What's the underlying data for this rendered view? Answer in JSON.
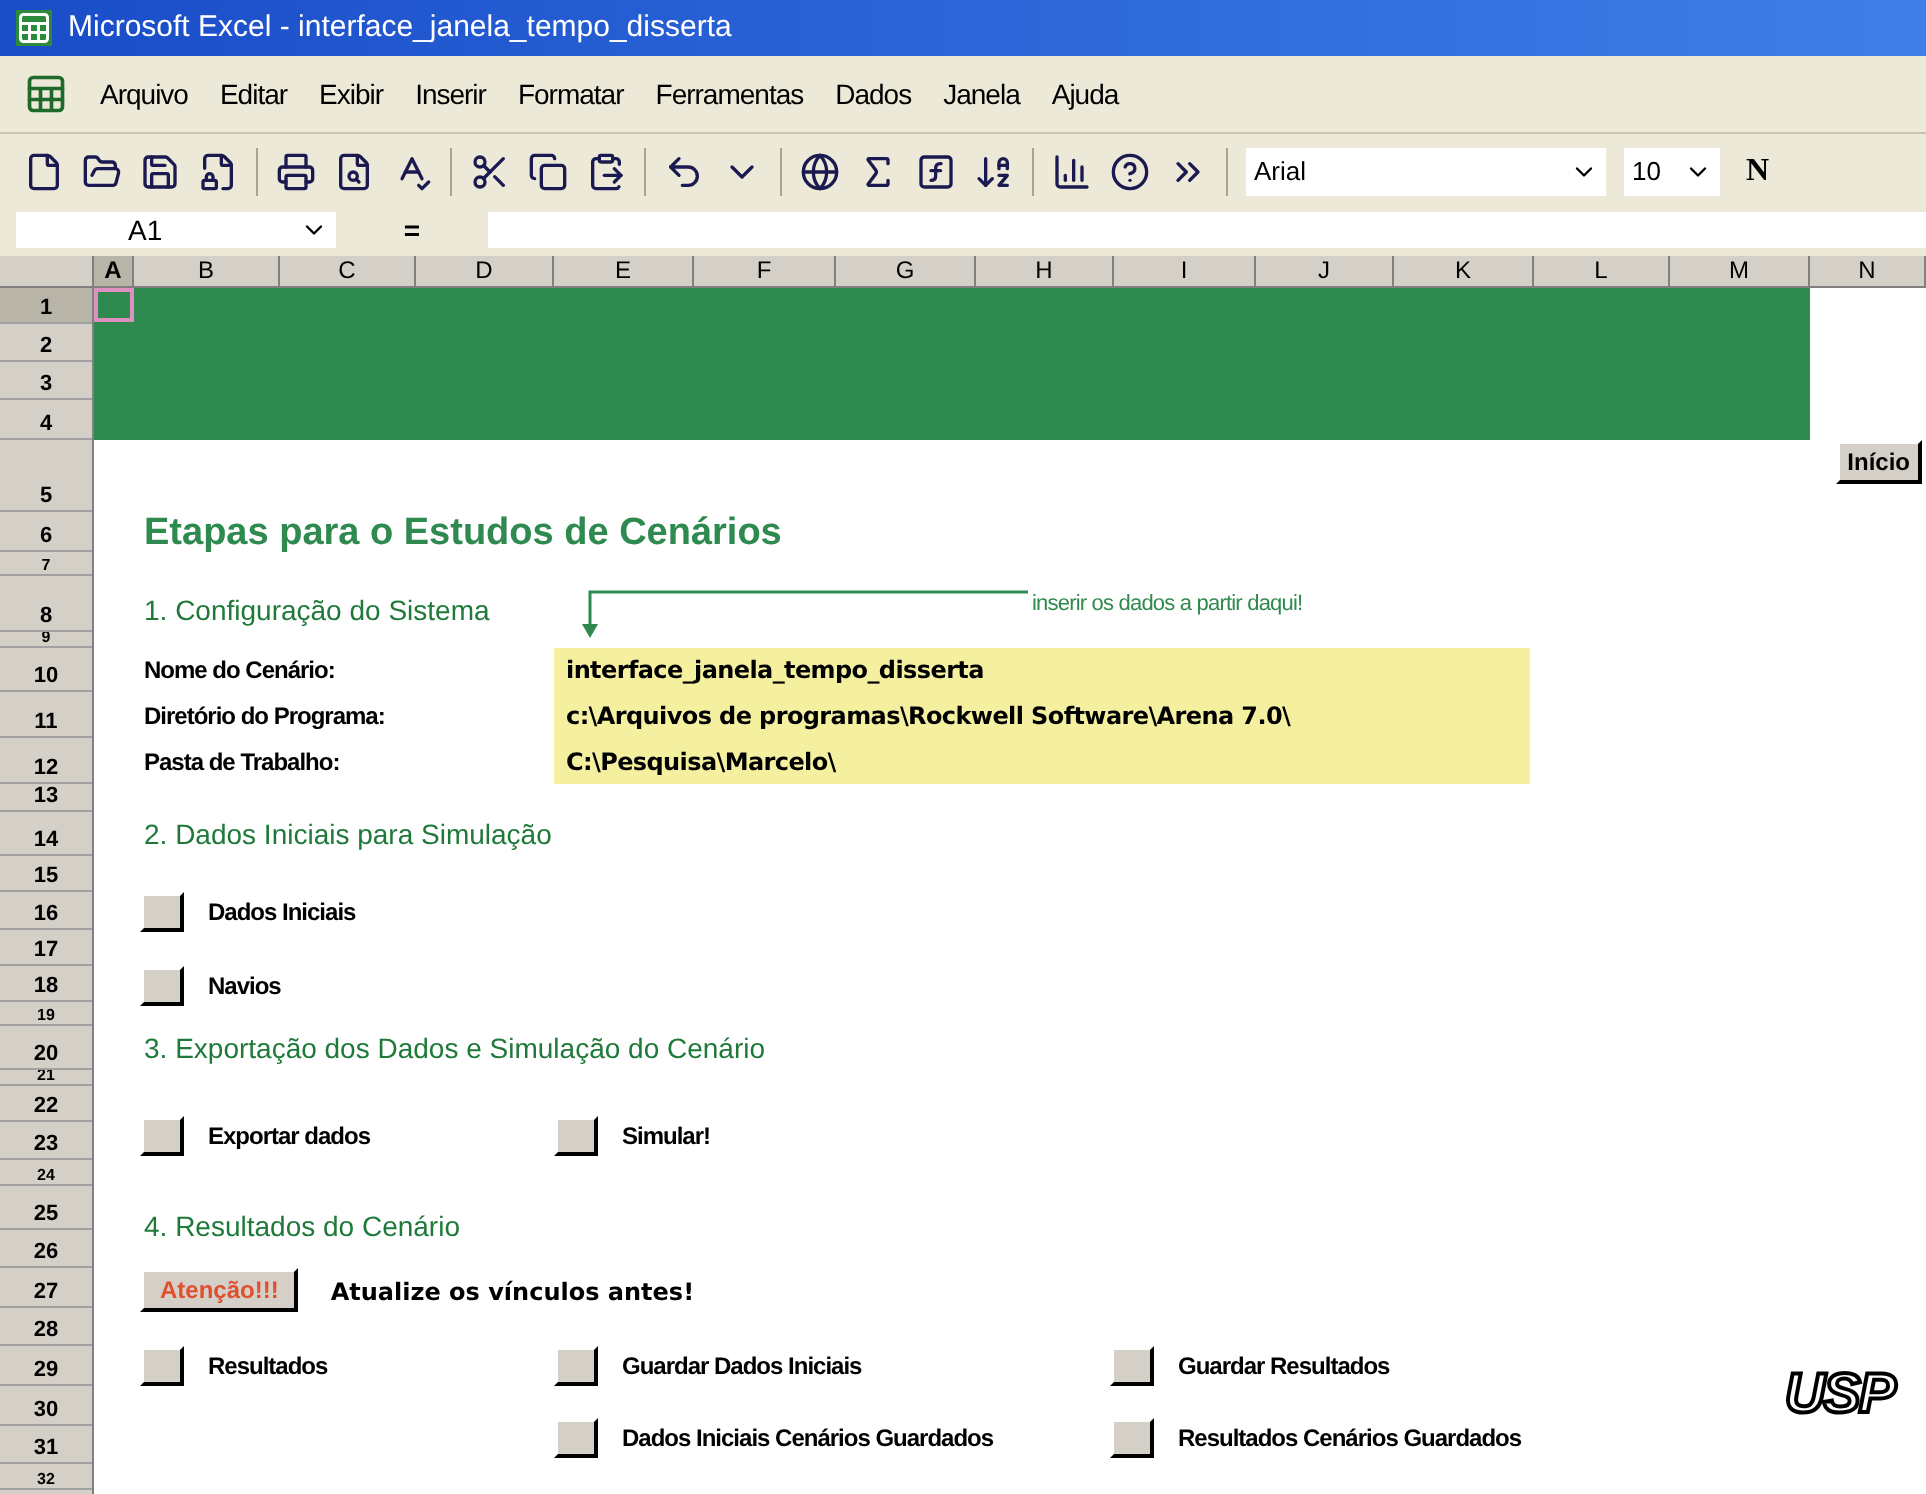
{
  "window": {
    "title": "Microsoft Excel - interface_janela_tempo_disserta"
  },
  "menu": [
    "Arquivo",
    "Editar",
    "Exibir",
    "Inserir",
    "Formatar",
    "Ferramentas",
    "Dados",
    "Janela",
    "Ajuda"
  ],
  "toolbar": {
    "font": "Arial",
    "font_size": "10",
    "bold": "N"
  },
  "formula_bar": {
    "cell": "A1",
    "equals": "="
  },
  "columns": [
    {
      "label": "A",
      "selected": true
    },
    {
      "label": "B",
      "selected": false
    },
    {
      "label": "C",
      "selected": false
    },
    {
      "label": "D",
      "selected": false
    },
    {
      "label": "E",
      "selected": false
    },
    {
      "label": "F",
      "selected": false
    },
    {
      "label": "G",
      "selected": false
    },
    {
      "label": "H",
      "selected": false
    },
    {
      "label": "I",
      "selected": false
    },
    {
      "label": "J",
      "selected": false
    },
    {
      "label": "K",
      "selected": false
    },
    {
      "label": "L",
      "selected": false
    },
    {
      "label": "M",
      "selected": false
    },
    {
      "label": "N",
      "selected": false
    }
  ],
  "rows": [
    {
      "label": "1",
      "selected": true
    },
    {
      "label": "2",
      "selected": false
    },
    {
      "label": "3",
      "selected": false
    },
    {
      "label": "4",
      "selected": false
    },
    {
      "label": "5",
      "selected": false
    },
    {
      "label": "6",
      "selected": false
    },
    {
      "label": "7",
      "selected": false
    },
    {
      "label": "8",
      "selected": false
    },
    {
      "label": "9",
      "selected": false
    },
    {
      "label": "10",
      "selected": false
    },
    {
      "label": "11",
      "selected": false
    },
    {
      "label": "12",
      "selected": false
    },
    {
      "label": "13",
      "selected": false
    },
    {
      "label": "14",
      "selected": false
    },
    {
      "label": "15",
      "selected": false
    },
    {
      "label": "16",
      "selected": false
    },
    {
      "label": "17",
      "selected": false
    },
    {
      "label": "18",
      "selected": false
    },
    {
      "label": "19",
      "selected": false
    },
    {
      "label": "20",
      "selected": false
    },
    {
      "label": "21",
      "selected": false
    },
    {
      "label": "22",
      "selected": false
    },
    {
      "label": "23",
      "selected": false
    },
    {
      "label": "24",
      "selected": false
    },
    {
      "label": "25",
      "selected": false
    },
    {
      "label": "26",
      "selected": false
    },
    {
      "label": "27",
      "selected": false
    },
    {
      "label": "28",
      "selected": false
    },
    {
      "label": "29",
      "selected": false
    },
    {
      "label": "30",
      "selected": false
    },
    {
      "label": "31",
      "selected": false
    },
    {
      "label": "32",
      "selected": false
    }
  ],
  "sheet": {
    "start_button": "Início",
    "title": "Etapas para o Estudos de Cenários",
    "config": {
      "heading": "1. Configuração do Sistema",
      "note": "inserir os dados a partir daqui!",
      "fields": [
        {
          "label": "Nome do Cenário:",
          "value": "interface_janela_tempo_disserta"
        },
        {
          "label": "Diretório do Programa:",
          "value": "c:\\Arquivos de programas\\Rockwell Software\\Arena 7.0\\"
        },
        {
          "label": "Pasta de Trabalho:",
          "value": "C:\\Pesquisa\\Marcelo\\"
        }
      ]
    },
    "initial_data": {
      "heading": "2. Dados Iniciais para Simulação",
      "buttons": [
        "Dados Iniciais",
        "Navios"
      ]
    },
    "export": {
      "heading": "3. Exportação dos Dados e Simulação do Cenário",
      "buttons": [
        "Exportar dados",
        "Simular!"
      ]
    },
    "results": {
      "heading": "4. Resultados do Cenário",
      "warning_button": "Atenção!!!",
      "warning_text": "Atualize os vínculos antes!",
      "button_rows": [
        [
          "Resultados",
          "Guardar Dados Iniciais",
          "Guardar Resultados"
        ],
        [
          "Dados Iniciais Cenários Guardados",
          "Resultados Cenários Guardados"
        ]
      ]
    },
    "logo": "USP"
  }
}
